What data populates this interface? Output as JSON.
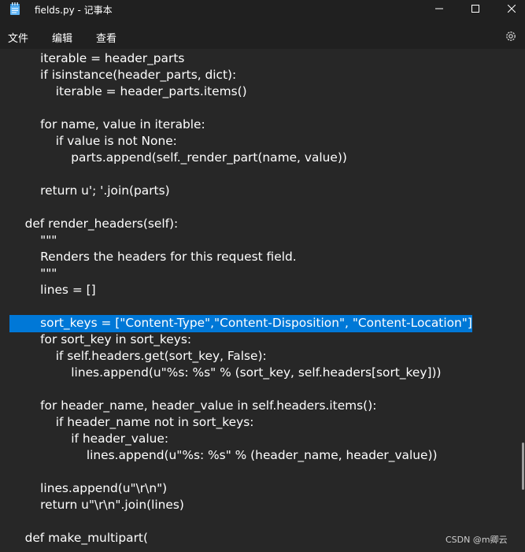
{
  "window": {
    "title": "fields.py - 记事本"
  },
  "icons": {
    "app": "notepad-icon",
    "minimize": "minimize-icon",
    "maximize": "maximize-icon",
    "close": "close-icon",
    "settings": "gear-icon"
  },
  "colors": {
    "background": "#272727",
    "titlebar": "#202020",
    "selection": "#0078d7",
    "text": "#ffffff"
  },
  "menu": {
    "file": "文件",
    "edit": "编辑",
    "view": "查看"
  },
  "editor": {
    "lines": [
      "        iterable = header_parts",
      "        if isinstance(header_parts, dict):",
      "            iterable = header_parts.items()",
      "",
      "        for name, value in iterable:",
      "            if value is not None:",
      "                parts.append(self._render_part(name, value))",
      "",
      "        return u'; '.join(parts)",
      "",
      "    def render_headers(self):",
      "        \"\"\"",
      "        Renders the headers for this request field.",
      "        \"\"\"",
      "        lines = []",
      "",
      "        sort_keys = [\"Content-Type\",\"Content-Disposition\", \"Content-Location\"]",
      "        for sort_key in sort_keys:",
      "            if self.headers.get(sort_key, False):",
      "                lines.append(u\"%s: %s\" % (sort_key, self.headers[sort_key]))",
      "",
      "        for header_name, header_value in self.headers.items():",
      "            if header_name not in sort_keys:",
      "                if header_value:",
      "                    lines.append(u\"%s: %s\" % (header_name, header_value))",
      "",
      "        lines.append(u\"\\r\\n\")",
      "        return u\"\\r\\n\".join(lines)",
      "",
      "    def make_multipart("
    ],
    "selected_line_index": 16
  },
  "watermark": "CSDN @m卿云"
}
